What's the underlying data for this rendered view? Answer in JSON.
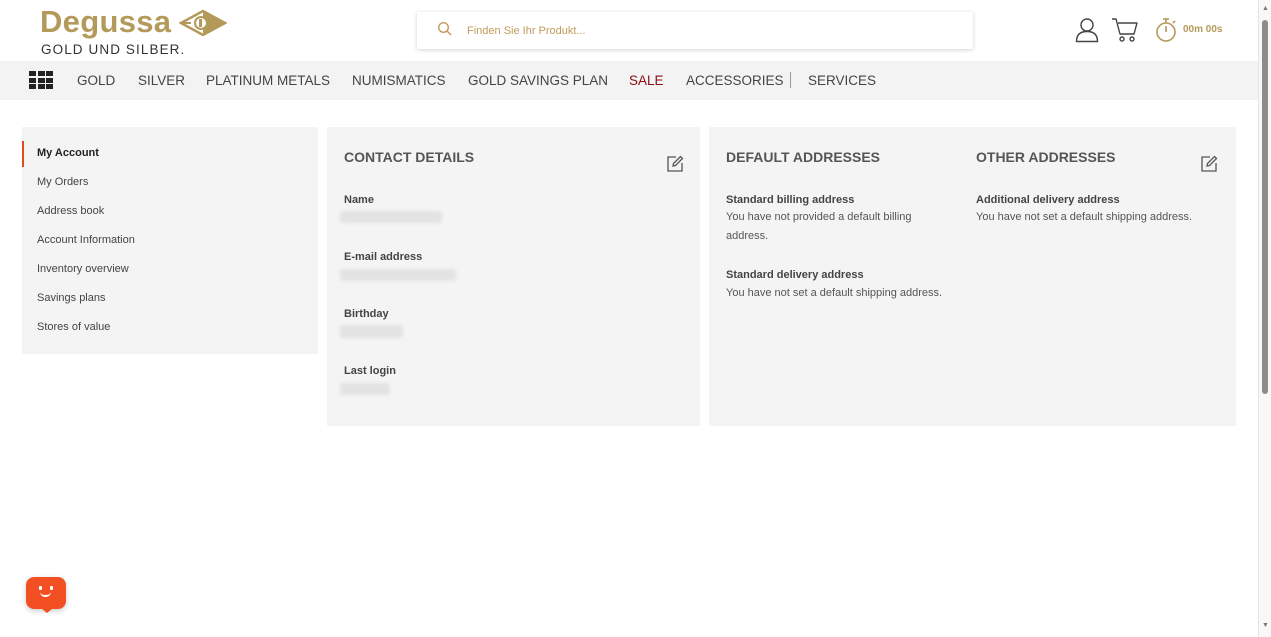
{
  "brand": {
    "name": "Degussa",
    "tagline": "GOLD UND SILBER.",
    "color": "#b49a5a"
  },
  "search": {
    "placeholder": "Finden Sie Ihr Produkt..."
  },
  "header": {
    "timer": "00m 00s",
    "icons": [
      "user-icon",
      "cart-icon",
      "stopwatch-icon"
    ]
  },
  "nav": {
    "items": [
      {
        "label": "GOLD"
      },
      {
        "label": "SILVER"
      },
      {
        "label": "PLATINUM METALS"
      },
      {
        "label": "NUMISMATICS"
      },
      {
        "label": "GOLD SAVINGS PLAN"
      },
      {
        "label": "SALE",
        "color": "#8b0d18"
      },
      {
        "label": "ACCESSORIES"
      },
      {
        "label": "SERVICES"
      }
    ]
  },
  "sidebar": {
    "items": [
      {
        "label": "My Account",
        "active": true
      },
      {
        "label": "My Orders"
      },
      {
        "label": "Address book"
      },
      {
        "label": "Account Information"
      },
      {
        "label": "Inventory overview"
      },
      {
        "label": "Savings plans"
      },
      {
        "label": "Stores of value"
      }
    ],
    "accent": "#e04a1c"
  },
  "contact": {
    "title": "CONTACT DETAILS",
    "fields": [
      {
        "label": "Name"
      },
      {
        "label": "E-mail address"
      },
      {
        "label": "Birthday"
      },
      {
        "label": "Last login"
      }
    ]
  },
  "addresses": {
    "default_title": "DEFAULT ADDRESSES",
    "other_title": "OTHER ADDRESSES",
    "billing_label": "Standard billing address",
    "billing_text": "You have not provided a default billing address.",
    "delivery_label": "Standard delivery address",
    "delivery_text": "You have not set a default shipping address.",
    "additional_label": "Additional delivery address",
    "additional_text": "You have not set a default shipping address."
  },
  "chat": {
    "color": "#f25022"
  }
}
